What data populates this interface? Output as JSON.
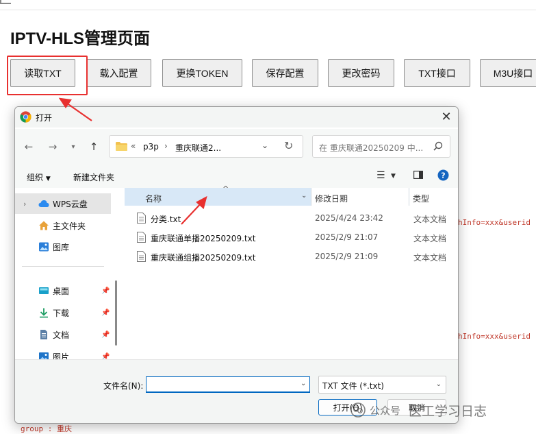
{
  "page": {
    "title": "IPTV-HLS管理页面",
    "buttons": [
      "读取TXT",
      "载入配置",
      "更换TOKEN",
      "保存配置",
      "更改密码",
      "TXT接口",
      "M3U接口"
    ],
    "code_snippets": [
      "hInfo=xxx&userid",
      "hInfo=xxx&userid"
    ],
    "code_bottom": "group : 重庆"
  },
  "dialog": {
    "title": "打开",
    "address": {
      "overflow": "«",
      "parts": [
        "p3p",
        "重庆联通2..."
      ]
    },
    "search_placeholder": "在 重庆联通20250209 中...",
    "toolbar": {
      "organize": "组织",
      "new_folder": "新建文件夹"
    },
    "nav_pane": [
      {
        "label": "WPS云盘",
        "icon": "cloud-icon",
        "selected": true
      },
      {
        "label": "主文件夹",
        "icon": "home-icon"
      },
      {
        "label": "图库",
        "icon": "gallery-icon"
      },
      {
        "label": "桌面",
        "icon": "desktop-icon",
        "pinned": true
      },
      {
        "label": "下载",
        "icon": "download-icon",
        "pinned": true
      },
      {
        "label": "文档",
        "icon": "document-icon",
        "pinned": true
      },
      {
        "label": "图片",
        "icon": "picture-icon",
        "pinned": true
      }
    ],
    "columns": {
      "name": "名称",
      "modified": "修改日期",
      "type": "类型"
    },
    "files": [
      {
        "name": "分类.txt",
        "modified": "2025/4/24 23:42",
        "type": "文本文档"
      },
      {
        "name": "重庆联通单播20250209.txt",
        "modified": "2025/2/9 21:07",
        "type": "文本文档"
      },
      {
        "name": "重庆联通组播20250209.txt",
        "modified": "2025/2/9 21:09",
        "type": "文本文档"
      }
    ],
    "filename_label": "文件名(N):",
    "filename_value": "",
    "filetype_value": "TXT 文件 (*.txt)",
    "open_label": "打开(O)",
    "cancel_label": "取消"
  },
  "watermark": {
    "text_a": "公众号",
    "text_b": "医工学习日志"
  },
  "colors": {
    "annotation_red": "#e8302f",
    "accent_blue": "#0067c0",
    "header_highlight": "#d8e8f7"
  }
}
